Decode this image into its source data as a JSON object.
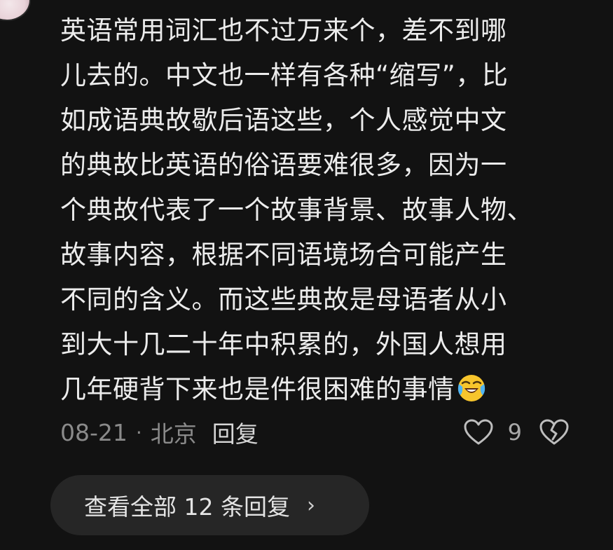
{
  "comment": {
    "lines": [
      "英语常用词汇也不过万来个，差不到哪",
      "儿去的。中文也一样有各种“缩写”，比",
      "如成语典故歇后语这些，个人感觉中文",
      "的典故比英语的俗语要难很多，因为一",
      "个典故代表了一个故事背景、故事人物、",
      "故事内容，根据不同语境场合可能产生",
      "不同的含义。而这些典故是母语者从小",
      "到大十几二十年中积累的，外国人想用",
      "几年硬背下来也是件很困难的事情"
    ],
    "emoji": "laughing-crying-emoji",
    "date": "08-21",
    "separator": "·",
    "location": "北京",
    "reply_label": "回复",
    "like_count": "9",
    "icons": {
      "like": "heart-outline-icon",
      "dislike": "broken-heart-icon",
      "chevron": "chevron-right-icon"
    }
  },
  "replies": {
    "view_all_label": "查看全部 12 条回复",
    "chevron": "›"
  },
  "colors": {
    "background": "#121212",
    "text": "#ececec",
    "meta": "#8a8a8a",
    "pill": "#262626"
  }
}
